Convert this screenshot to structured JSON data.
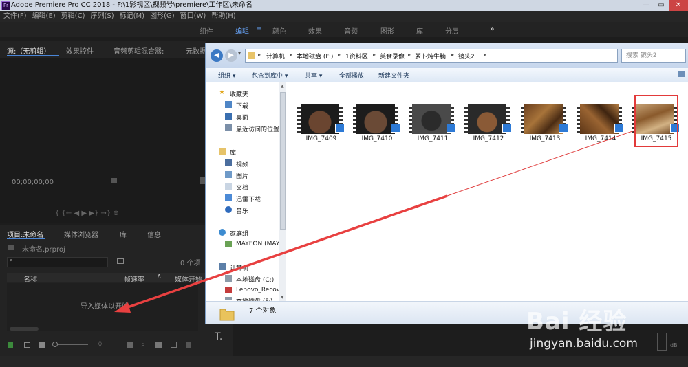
{
  "premiere": {
    "title": "Adobe Premiere Pro CC 2018 - F:\\1影视区\\视频号\\premiere\\工作区\\未命名",
    "logo": "Pr",
    "menu": [
      "文件(F)",
      "编辑(E)",
      "剪辑(C)",
      "序列(S)",
      "标记(M)",
      "图形(G)",
      "窗口(W)",
      "帮助(H)"
    ],
    "workspaces": [
      "组件",
      "编辑",
      "颜色",
      "效果",
      "音频",
      "图形",
      "库",
      "分层"
    ],
    "workspace_more": "»",
    "source_tabs": [
      "源:（无剪辑）",
      "效果控件",
      "音频剪辑混合器:",
      "元数据"
    ],
    "source_timecode": "00;00;00;00",
    "source_controls": "{ {← ◀ ▶ ▶} →} ⊕",
    "project_tabs": [
      "项目:未命名",
      "媒体浏览器",
      "库",
      "信息"
    ],
    "project_file": "未命名.prproj",
    "project_count": "0 个项",
    "col_name": "名称",
    "col_fps": "帧速率",
    "col_media_start": "媒体开始",
    "empty_text": "导入媒体以开始",
    "tool_text": "T.",
    "db_label": "dB"
  },
  "explorer": {
    "breadcrumb": [
      "计算机",
      "本地磁盘 (F:)",
      "1资料区",
      "美食录像",
      "萝卜炖牛腩",
      "镜头2"
    ],
    "search_placeholder": "搜索 镜头2",
    "toolbar": [
      "组织 ▾",
      "包含到库中 ▾",
      "共享 ▾",
      "全部播放",
      "新建文件夹"
    ],
    "nav": [
      {
        "label": "收藏夹",
        "icon": "star-icon"
      },
      {
        "label": "下载",
        "icon": "download-folder-icon"
      },
      {
        "label": "桌面",
        "icon": "desktop-icon"
      },
      {
        "label": "最近访问的位置",
        "icon": "recent-icon"
      },
      {
        "label": "库",
        "icon": "library-icon"
      },
      {
        "label": "视频",
        "icon": "video-lib-icon"
      },
      {
        "label": "图片",
        "icon": "picture-lib-icon"
      },
      {
        "label": "文档",
        "icon": "document-lib-icon"
      },
      {
        "label": "迅雷下载",
        "icon": "thunder-icon"
      },
      {
        "label": "音乐",
        "icon": "music-icon"
      },
      {
        "label": "家庭组",
        "icon": "homegroup-icon"
      },
      {
        "label": "MAYEON (MAY",
        "icon": "user-icon"
      },
      {
        "label": "计算机",
        "icon": "computer-icon"
      },
      {
        "label": "本地磁盘 (C:)",
        "icon": "disk-icon"
      },
      {
        "label": "Lenovo_Recove",
        "icon": "disk-icon"
      },
      {
        "label": "本地磁盘 (F:)",
        "icon": "disk-icon"
      }
    ],
    "files": [
      "IMG_7409",
      "IMG_7410",
      "IMG_7411",
      "IMG_7412",
      "IMG_7413",
      "IMG_7414",
      "IMG_7415"
    ],
    "status": "7 个对象"
  },
  "watermark": {
    "logo": "Bai 经验",
    "url": "jingyan.baidu.com"
  }
}
